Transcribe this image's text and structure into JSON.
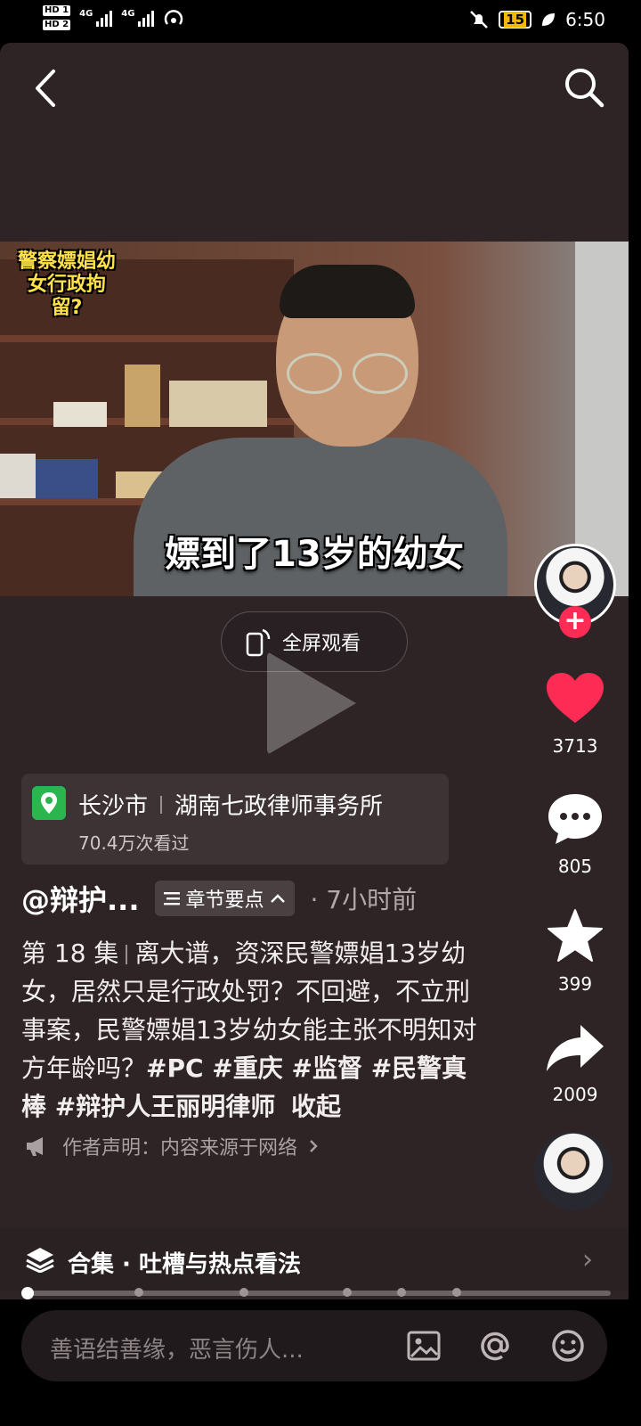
{
  "status_bar": {
    "hd1": "HD 1",
    "hd2": "HD 2",
    "net1": "4G",
    "net2": "4G",
    "battery": "15",
    "time": "6:50"
  },
  "video": {
    "overlay_tag": "警察嫖娼幼女行政拘留?",
    "caption": "嫖到了13岁的幼女"
  },
  "fullscreen_button": {
    "label": "全屏观看"
  },
  "location": {
    "city": "长沙市",
    "place": "湖南七政律师事务所",
    "views": "70.4万次看过"
  },
  "author": {
    "name": "@辩护...",
    "chapter_button": "章节要点",
    "time_ago": "· 7小时前"
  },
  "description": {
    "episode": "第 18 集",
    "text": "离大谱，资深民警嫖娼13岁幼女，居然只是行政处罚？不回避，不立刑事案，民警嫖娼13岁幼女能主张不明知对方年龄吗？",
    "hashtags": "#PC #重庆  #监督  #民警真棒 #辩护人王丽明律师",
    "collapse": "收起"
  },
  "declaration": "作者声明：内容来源于网络",
  "collection": {
    "label": "合集 · 吐槽与热点看法"
  },
  "playback_progress": 0,
  "actions": {
    "likes": "3713",
    "comments": "805",
    "favorites": "399",
    "shares": "2009"
  },
  "comment_bar": {
    "placeholder": "善语结善缘，恶言伤人..."
  },
  "colors": {
    "accent": "#fe2c55",
    "panel": "#2e2426",
    "location_pin": "#2ab54f"
  }
}
